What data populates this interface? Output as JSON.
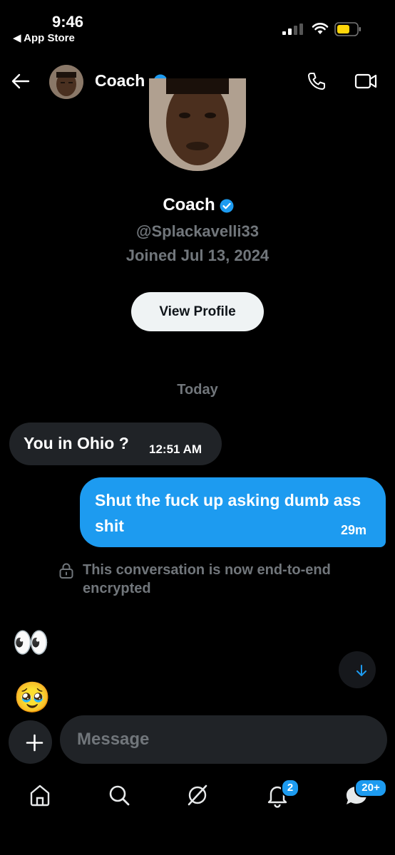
{
  "status_bar": {
    "time": "9:46",
    "back_app": "◀ App Store"
  },
  "header": {
    "contact_name": "Coach"
  },
  "profile": {
    "name": "Coach",
    "handle": "@Splackavelli33",
    "joined": "Joined Jul 13, 2024",
    "view_profile_label": "View Profile"
  },
  "conversation": {
    "date_divider": "Today",
    "messages": [
      {
        "direction": "incoming",
        "text": "You in Ohio ?",
        "time": "12:51 AM"
      },
      {
        "direction": "outgoing",
        "text": "Shut the fuck up asking dumb ass shit",
        "time": "29m"
      }
    ],
    "encryption_notice": "This conversation is now end-to-end encrypted",
    "reactions": [
      "👀",
      "🥹"
    ]
  },
  "composer": {
    "placeholder": "Message"
  },
  "tab_bar": {
    "tabs": [
      "home",
      "search",
      "grok",
      "notifications",
      "messages"
    ],
    "notifications_badge": "2",
    "messages_badge": "20+"
  },
  "colors": {
    "accent": "#1d9bf0",
    "background": "#000000",
    "bubble_incoming": "#202327",
    "muted_text": "#71767b"
  }
}
